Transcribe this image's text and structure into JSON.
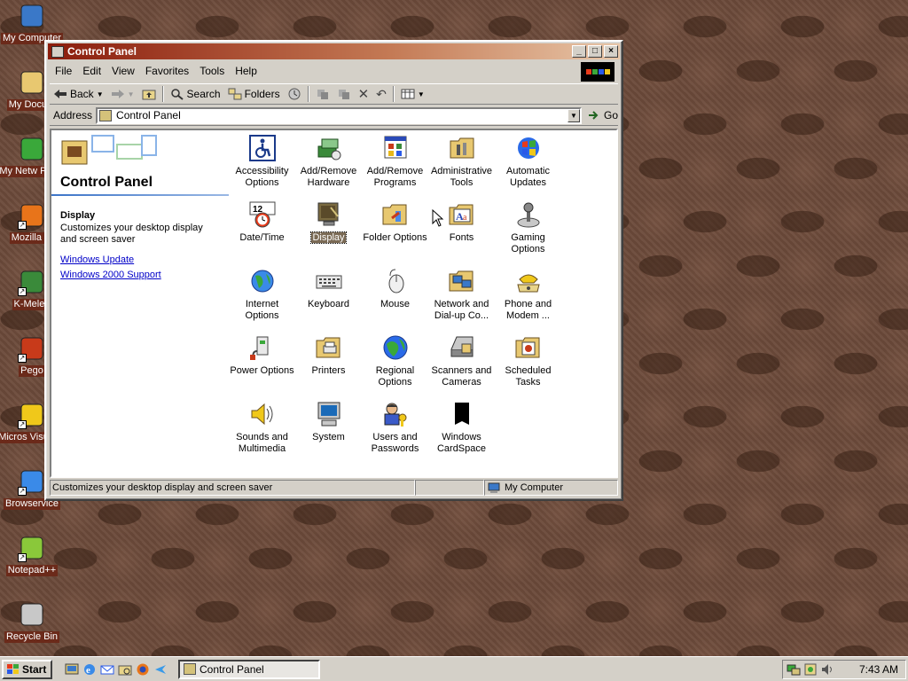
{
  "desktop": {
    "icons": [
      {
        "label": "My Computer",
        "icon": "my-computer-icon"
      },
      {
        "label": "My Docum",
        "icon": "my-documents-icon"
      },
      {
        "label": "My Netw Place",
        "icon": "network-places-icon"
      },
      {
        "label": "Mozilla Fi",
        "icon": "firefox-icon"
      },
      {
        "label": "K-Meleo",
        "icon": "k-meleon-icon"
      },
      {
        "label": "Pego",
        "icon": "pegasus-icon"
      },
      {
        "label": "Micros Visual S",
        "icon": "visual-studio-icon"
      },
      {
        "label": "Browservice",
        "icon": "ie-icon"
      },
      {
        "label": "Notepad++",
        "icon": "notepad-icon"
      },
      {
        "label": "Recycle Bin",
        "icon": "recycle-bin-icon"
      }
    ]
  },
  "window": {
    "title": "Control Panel",
    "menu": [
      "File",
      "Edit",
      "View",
      "Favorites",
      "Tools",
      "Help"
    ],
    "toolbar": {
      "back": "Back",
      "search": "Search",
      "folders": "Folders"
    },
    "address": {
      "label": "Address",
      "value": "Control Panel",
      "go": "Go"
    },
    "left_pane": {
      "title": "Control Panel",
      "selected_name": "Display",
      "selected_desc": "Customizes your desktop display and screen saver",
      "links": [
        "Windows Update",
        "Windows 2000 Support"
      ]
    },
    "items": [
      {
        "label": "Accessibility Options",
        "icon": "accessibility-icon"
      },
      {
        "label": "Add/Remove Hardware",
        "icon": "add-hardware-icon"
      },
      {
        "label": "Add/Remove Programs",
        "icon": "add-programs-icon"
      },
      {
        "label": "Administrative Tools",
        "icon": "admin-tools-icon"
      },
      {
        "label": "Automatic Updates",
        "icon": "windows-update-icon"
      },
      {
        "label": "Date/Time",
        "icon": "clock-calendar-icon"
      },
      {
        "label": "Display",
        "icon": "display-icon"
      },
      {
        "label": "Folder Options",
        "icon": "folder-options-icon"
      },
      {
        "label": "Fonts",
        "icon": "fonts-icon"
      },
      {
        "label": "Gaming Options",
        "icon": "joystick-icon"
      },
      {
        "label": "Internet Options",
        "icon": "globe-icon"
      },
      {
        "label": "Keyboard",
        "icon": "keyboard-icon"
      },
      {
        "label": "Mouse",
        "icon": "mouse-icon"
      },
      {
        "label": "Network and Dial-up Co...",
        "icon": "network-icon"
      },
      {
        "label": "Phone and Modem ...",
        "icon": "phone-icon"
      },
      {
        "label": "Power Options",
        "icon": "power-icon"
      },
      {
        "label": "Printers",
        "icon": "printer-icon"
      },
      {
        "label": "Regional Options",
        "icon": "globe-regional-icon"
      },
      {
        "label": "Scanners and Cameras",
        "icon": "scanner-icon"
      },
      {
        "label": "Scheduled Tasks",
        "icon": "scheduled-tasks-icon"
      },
      {
        "label": "Sounds and Multimedia",
        "icon": "speaker-icon"
      },
      {
        "label": "System",
        "icon": "computer-icon"
      },
      {
        "label": "Users and Passwords",
        "icon": "users-icon"
      },
      {
        "label": "Windows CardSpace",
        "icon": "cardspace-icon"
      }
    ],
    "selected_item": "Display",
    "status": {
      "text": "Customizes your desktop display and screen saver",
      "zone": "My Computer"
    }
  },
  "taskbar": {
    "start": "Start",
    "task": "Control Panel",
    "clock": "7:43 AM"
  },
  "colors": {
    "titlebar_start": "#8b1c0c",
    "desktop": "#6b4a3a",
    "link": "#0000c8"
  }
}
